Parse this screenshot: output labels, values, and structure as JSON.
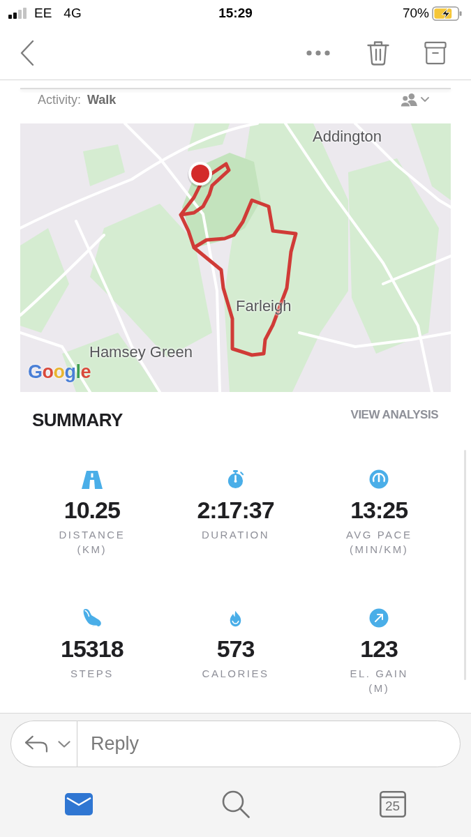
{
  "status_bar": {
    "carrier": "EE",
    "network": "4G",
    "time": "15:29",
    "battery": "70%"
  },
  "activity": {
    "label": "Activity:",
    "value": "Walk"
  },
  "map": {
    "places": [
      "Addington",
      "Farleigh",
      "Hamsey Green"
    ],
    "attribution": "Google"
  },
  "summary": {
    "title": "SUMMARY",
    "link": "VIEW ANALYSIS",
    "stats": [
      {
        "kind": "distance",
        "value": "10.25",
        "label": "DISTANCE",
        "unit": "(KM)"
      },
      {
        "kind": "duration",
        "value": "2:17:37",
        "label": "DURATION"
      },
      {
        "kind": "pace",
        "value": "13:25",
        "label": "AVG PACE",
        "unit": "(MIN/KM)"
      },
      {
        "kind": "steps",
        "value": "15318",
        "label": "STEPS"
      },
      {
        "kind": "calories",
        "value": "573",
        "label": "CALORIES"
      },
      {
        "kind": "elevation",
        "value": "123",
        "label": "EL. GAIN",
        "unit": "(M)"
      }
    ]
  },
  "reply": {
    "placeholder": "Reply"
  },
  "tab_bar": [
    {
      "kind": "mail",
      "selected": true
    },
    {
      "kind": "search",
      "selected": false
    },
    {
      "kind": "calendar",
      "label": "25",
      "selected": false
    }
  ]
}
